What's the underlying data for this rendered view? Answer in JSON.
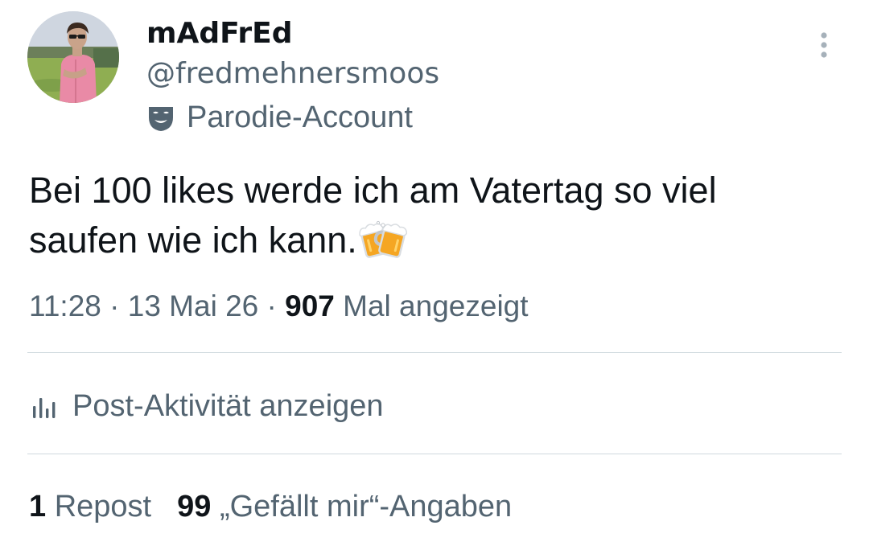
{
  "author": {
    "display_name": "mAdFrEd",
    "handle": "@fredmehnersmoos",
    "badge_label": "Parodie-Account",
    "badge_icon": "parody-mask-icon",
    "avatar_icon": "profile-photo"
  },
  "menu_icon": "more-vertical-icon",
  "post": {
    "text_line1": "Bei 100 likes werde ich am Vatertag so viel",
    "text_line2": "saufen wie ich kann.",
    "emoji": "clinking-beer-mugs"
  },
  "meta": {
    "time": "11:28",
    "separator": " · ",
    "date": "13 Mai 26",
    "views_count": "907",
    "views_label": " Mal angezeigt"
  },
  "activity": {
    "label": "Post-Aktivität anzeigen",
    "icon": "analytics-bars-icon"
  },
  "stats": {
    "reposts_count": "1",
    "reposts_label": " Repost",
    "likes_count": "99",
    "likes_label": " „Gefällt mir“-Angaben"
  },
  "colors": {
    "primary_text": "#0f1419",
    "secondary_text": "#536471",
    "divider": "#cfd9de",
    "background": "#ffffff"
  }
}
